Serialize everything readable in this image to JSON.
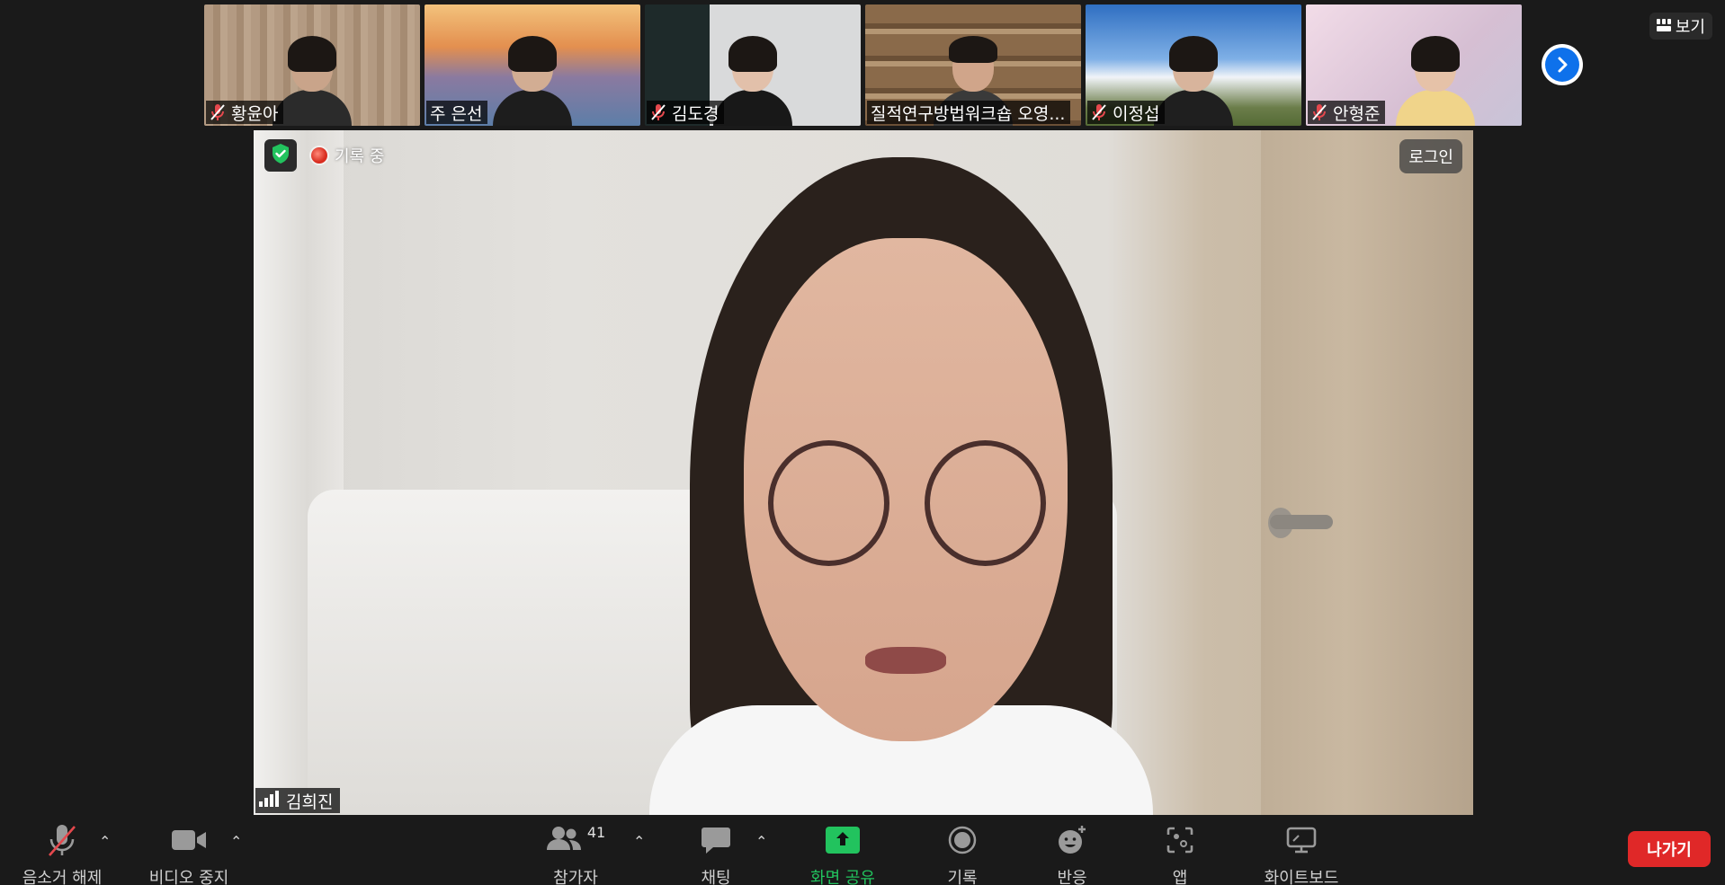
{
  "view_button": {
    "label": "보기",
    "icon": "grid-icon"
  },
  "strip": {
    "participants": [
      {
        "name": "황윤아",
        "muted": true,
        "bg": "#b39a82"
      },
      {
        "name": "주 은선",
        "muted": false,
        "bg": "#c07a4a"
      },
      {
        "name": "김도경",
        "muted": true,
        "bg": "#8a8f98"
      },
      {
        "name": "질적연구방법워크숍 오영...",
        "muted": false,
        "bg": "#8a6a4a"
      },
      {
        "name": "이정섭",
        "muted": true,
        "bg": "#3f7fc9"
      },
      {
        "name": "안형준",
        "muted": true,
        "bg": "#ddc8d8"
      }
    ],
    "next_icon": "chevron-right-icon"
  },
  "main_video": {
    "recording_label": "기록 중",
    "login_label": "로그인",
    "speaker_name": "김희진",
    "signal_icon": "signal-bars-icon",
    "security_icon": "shield-check-icon"
  },
  "toolbar": {
    "audio": {
      "label": "음소거 해제",
      "icon": "mic-muted-icon"
    },
    "video": {
      "label": "비디오 중지",
      "icon": "video-camera-icon"
    },
    "participants": {
      "label": "참가자",
      "count": "41",
      "icon": "people-icon"
    },
    "chat": {
      "label": "채팅",
      "icon": "chat-bubble-icon"
    },
    "share": {
      "label": "화면 공유",
      "icon": "share-screen-icon"
    },
    "record": {
      "label": "기록",
      "icon": "record-icon"
    },
    "reactions": {
      "label": "반응",
      "icon": "emoji-plus-icon"
    },
    "apps": {
      "label": "앱",
      "icon": "apps-icon"
    },
    "whiteboard": {
      "label": "화이트보드",
      "icon": "whiteboard-icon"
    },
    "leave": {
      "label": "나가기"
    }
  },
  "colors": {
    "accent_blue": "#0e71eb",
    "share_green": "#22c35e",
    "leave_red": "#e02828",
    "mute_red": "#e5484d"
  }
}
